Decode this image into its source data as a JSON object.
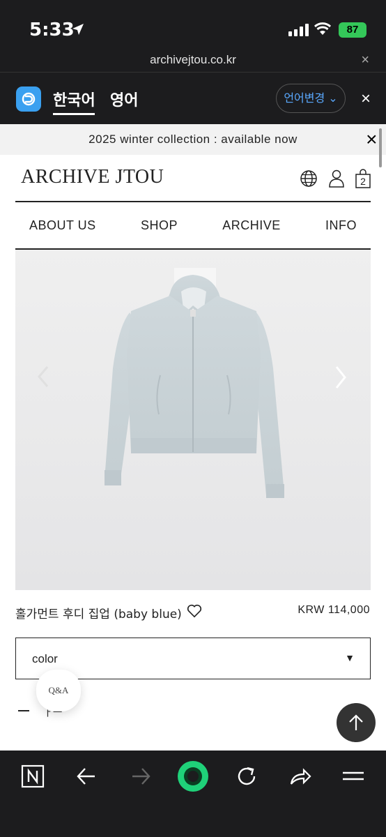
{
  "status_bar": {
    "time": "5:33",
    "battery": "87"
  },
  "browser": {
    "url": "archivejtou.co.kr",
    "close": "×"
  },
  "translate": {
    "current_lang": "한국어",
    "other_lang": "영어",
    "change_label": "언어변경 ⌄",
    "close": "×"
  },
  "announcement": {
    "text": "2025 winter collection : available now",
    "close": "×"
  },
  "site": {
    "logo": "ARCHIVE JTOU",
    "cart_count": "2",
    "nav": [
      "ABOUT US",
      "SHOP",
      "ARCHIVE",
      "INFO"
    ]
  },
  "product": {
    "name": "홀가먼트 후디 집업 (baby blue)",
    "price": "KRW 114,000",
    "color_label": "color",
    "color_arrow": "▼",
    "qa_label": "Q&A",
    "partial_text": "ㅏㅡ"
  },
  "icons": [
    "location-arrow-icon",
    "signal-icon",
    "wifi-icon",
    "globe-icon",
    "user-icon",
    "bag-icon",
    "chevron-right-icon",
    "heart-icon",
    "arrow-up-icon",
    "n-icon",
    "back-icon",
    "forward-icon",
    "record-icon",
    "refresh-icon",
    "share-icon",
    "menu-icon"
  ],
  "colors": {
    "chrome": "#1c1c1e",
    "accent_blue": "#5aa9ff",
    "battery_green": "#34c759",
    "record_green": "#1fd179"
  }
}
